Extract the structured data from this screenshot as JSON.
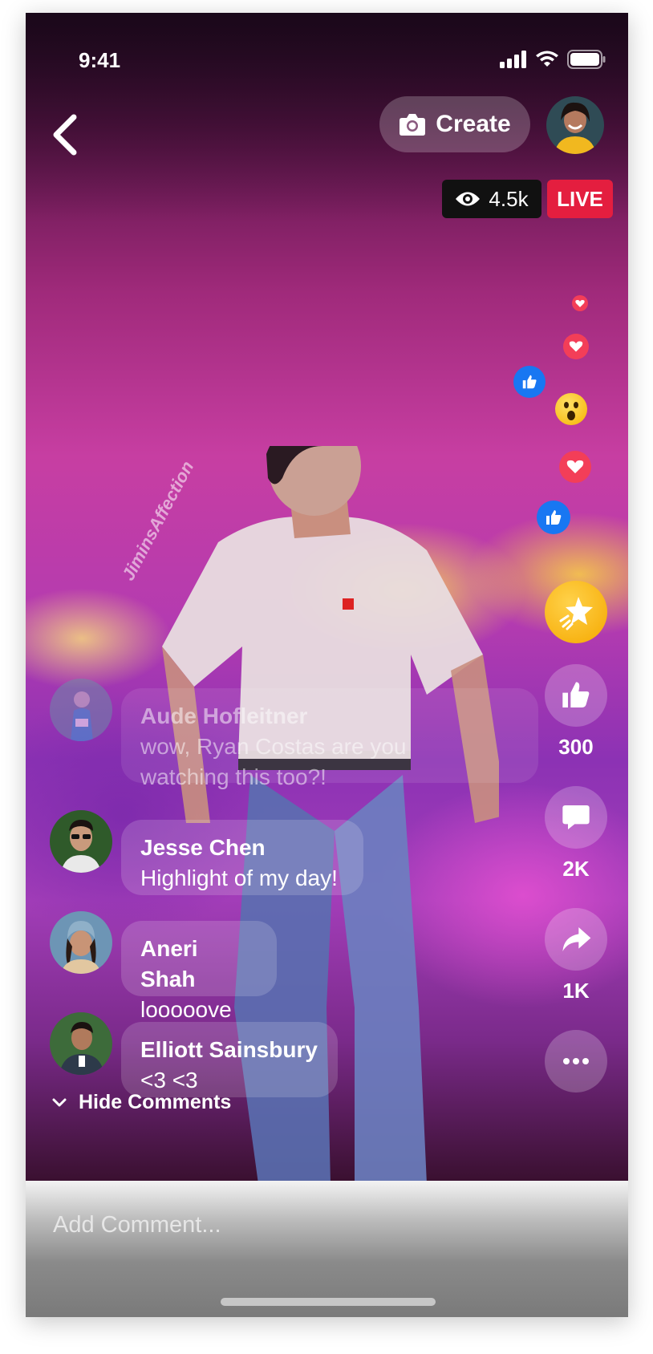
{
  "status": {
    "time": "9:41"
  },
  "header": {
    "create_label": "Create"
  },
  "stream": {
    "viewers": "4.5k",
    "live_label": "LIVE",
    "watermark": "JiminsAffection"
  },
  "actions": [
    {
      "icon": "star-icon",
      "count": ""
    },
    {
      "icon": "like-icon",
      "count": "300"
    },
    {
      "icon": "comment-icon",
      "count": "2K"
    },
    {
      "icon": "share-icon",
      "count": "1K"
    },
    {
      "icon": "more-icon",
      "count": ""
    }
  ],
  "comments": [
    {
      "name": "Aude Hofleitner",
      "text_line1": "wow, Ryan Costas are you",
      "text_line2": "watching this too?!"
    },
    {
      "name": "Jesse Chen",
      "text": "Highlight of my day!"
    },
    {
      "name": "Aneri Shah",
      "text": "looooove"
    },
    {
      "name": "Elliott Sainsbury",
      "text": "<3 <3"
    }
  ],
  "hide_comments_label": "Hide Comments",
  "input": {
    "placeholder": "Add Comment..."
  },
  "colors": {
    "live": "#e41e3f",
    "like_blue": "#1877f2",
    "love_red": "#f33e58",
    "star_gold": "#f5a800"
  }
}
